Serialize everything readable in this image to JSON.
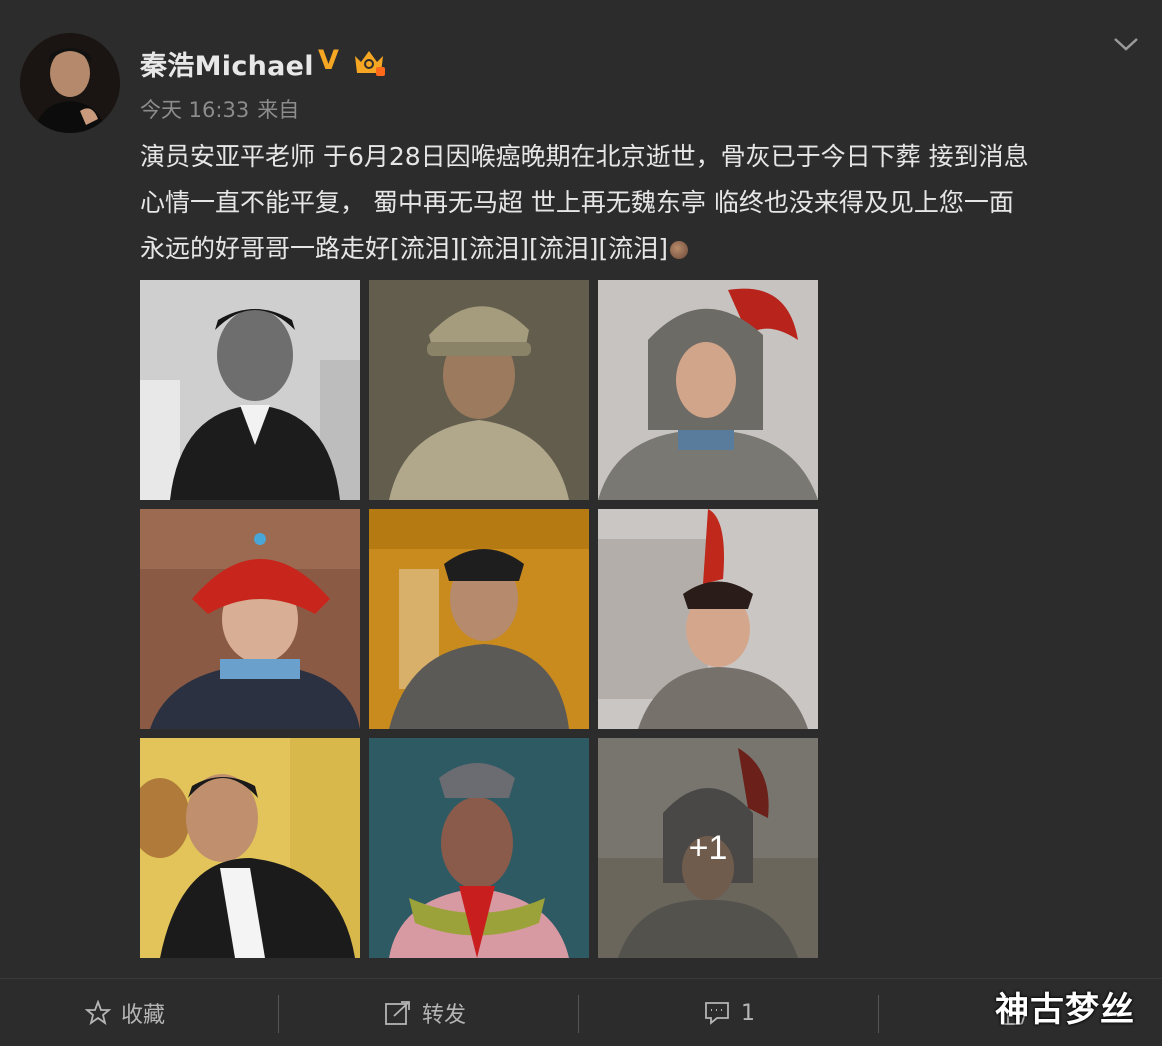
{
  "post": {
    "username": "秦浩Michael",
    "verified_mark": "V",
    "timestamp": "今天 16:33",
    "source": "来自",
    "text_lines": [
      "演员安亚平老师 于6月28日因喉癌晚期在北京逝世，骨灰已于今日下葬 接到消息",
      "心情一直不能平复， 蜀中再无马超 世上再无魏东亭 临终也没来得及见上您一面",
      "永远的好哥哥一路走好[流泪][流泪][流泪][流泪]"
    ],
    "more_images_label": "+1"
  },
  "images": [
    {
      "name": "photo-smiling-portrait-bw"
    },
    {
      "name": "photo-soldier-cap"
    },
    {
      "name": "photo-general-helmet"
    },
    {
      "name": "photo-qing-official-red-hat"
    },
    {
      "name": "photo-qing-official-armor"
    },
    {
      "name": "photo-warrior-red-plume"
    },
    {
      "name": "photo-casual-portrait"
    },
    {
      "name": "photo-costume-red-scarf"
    },
    {
      "name": "photo-general-helmet-2"
    }
  ],
  "footer": {
    "favorite_label": "收藏",
    "repost_label": "转发",
    "comment_count": "1"
  },
  "watermark": "神古梦丝",
  "colors": {
    "background": "#2c2c2c",
    "text": "#e6e6e6",
    "meta": "#8c8c8c",
    "verified": "#f5a623"
  }
}
